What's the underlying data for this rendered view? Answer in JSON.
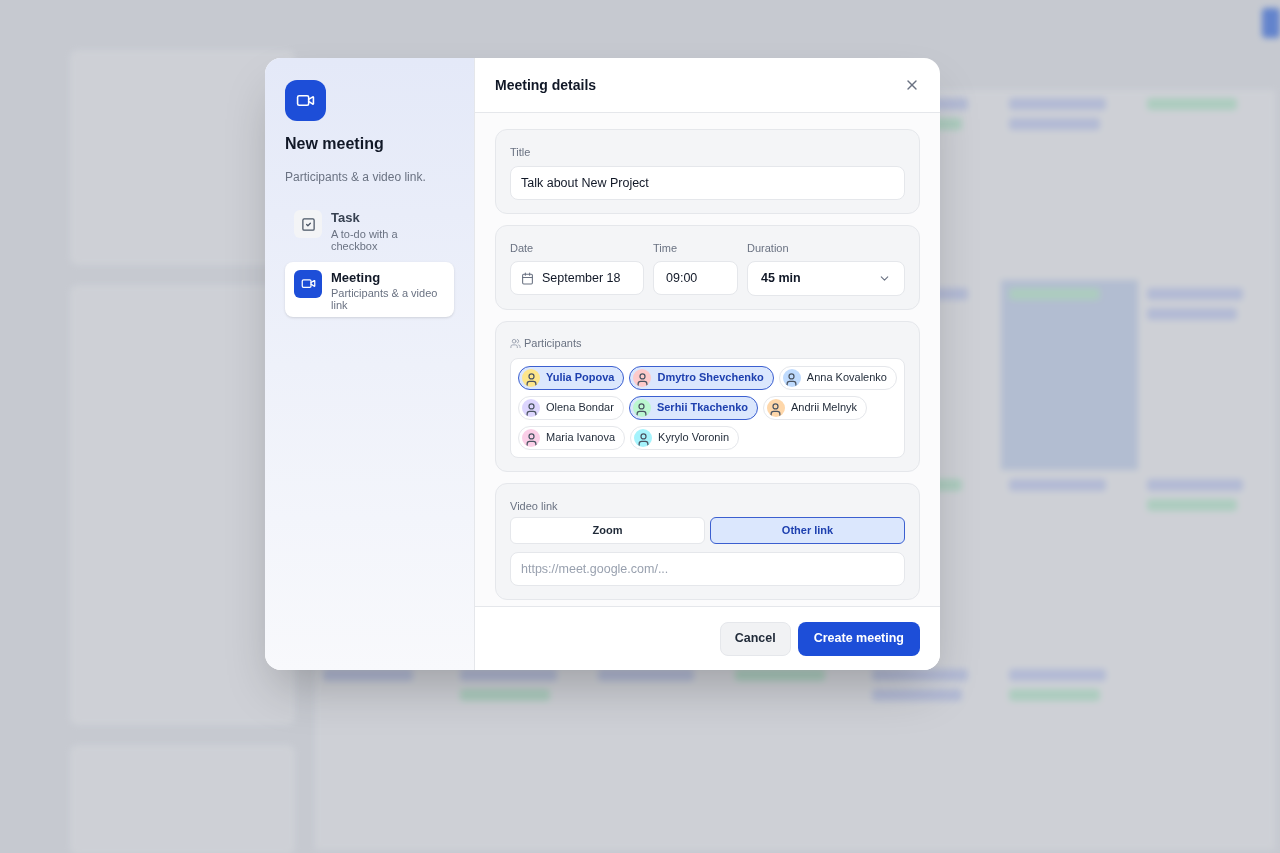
{
  "sidebar": {
    "title": "New meeting",
    "subtitle": "Participants & a video link.",
    "types": [
      {
        "kind": "task",
        "label": "Task",
        "description": "A to-do with a checkbox",
        "selected": false
      },
      {
        "kind": "meeting",
        "label": "Meeting",
        "description": "Participants & a video link",
        "selected": true
      }
    ]
  },
  "details": {
    "title": "Meeting details",
    "title_field": {
      "label": "Title",
      "value": "Talk about New Project"
    },
    "date": {
      "label": "Date",
      "value": "September 18"
    },
    "time": {
      "label": "Time",
      "value": "09:00"
    },
    "duration": {
      "label": "Duration",
      "value": "45 min"
    },
    "participants": {
      "label": "Participants",
      "people": [
        {
          "name": "Yulia Popova",
          "selected": true
        },
        {
          "name": "Dmytro Shevchenko",
          "selected": true
        },
        {
          "name": "Anna Kovalenko",
          "selected": false
        },
        {
          "name": "Olena Bondar",
          "selected": false
        },
        {
          "name": "Serhii Tkachenko",
          "selected": true
        },
        {
          "name": "Andrii Melnyk",
          "selected": false
        },
        {
          "name": "Maria Ivanova",
          "selected": false
        },
        {
          "name": "Kyrylo Voronin",
          "selected": false
        }
      ]
    },
    "video": {
      "label": "Video link",
      "options": [
        {
          "label": "Zoom",
          "selected": false
        },
        {
          "label": "Other link",
          "selected": true
        }
      ],
      "placeholder": "https://meet.google.com/..."
    }
  },
  "footer": {
    "buttons": [
      {
        "kind": "secondary",
        "label": "Cancel"
      },
      {
        "kind": "primary",
        "label": "Create meeting"
      }
    ]
  }
}
